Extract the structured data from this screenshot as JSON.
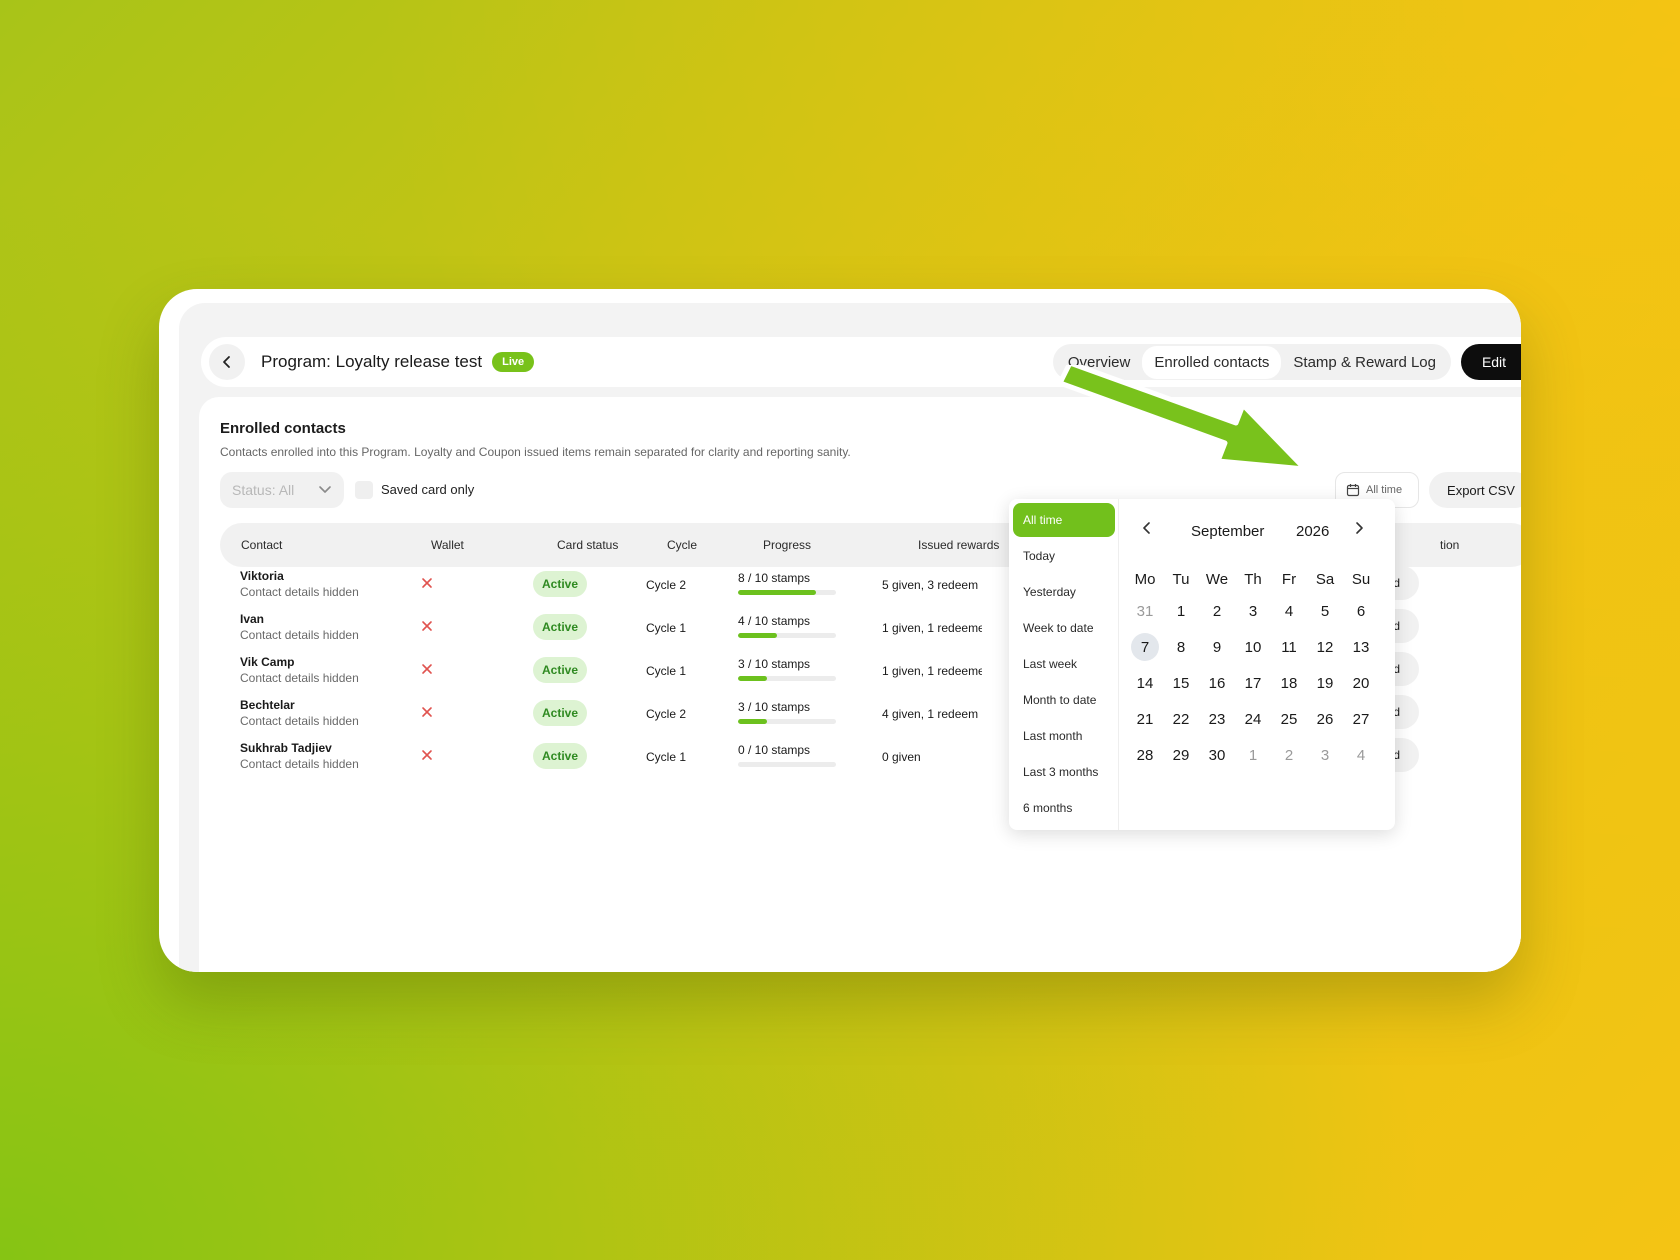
{
  "header": {
    "title": "Program: Loyalty release test",
    "badge": "Live",
    "tabs": [
      {
        "label": "Overview"
      },
      {
        "label": "Enrolled contacts"
      },
      {
        "label": "Stamp & Reward Log"
      }
    ],
    "edit_label": "Edit"
  },
  "section": {
    "title": "Enrolled contacts",
    "description": "Contacts enrolled into this Program. Loyalty and Coupon issued items remain separated for clarity and reporting sanity."
  },
  "filters": {
    "status_value": "Status: All",
    "saved_card_label": "Saved card only",
    "date_range_label": "All time",
    "export_label": "Export CSV"
  },
  "table": {
    "headers": {
      "contact": "Contact",
      "wallet": "Wallet",
      "card_status": "Card status",
      "cycle": "Cycle",
      "progress": "Progress",
      "issued_rewards": "Issued rewards",
      "action_partial": "tion"
    },
    "rows": [
      {
        "name": "Viktoria",
        "sub": "Contact details hidden",
        "status": "Active",
        "cycle": "Cycle 2",
        "progress_text": "8 / 10 stamps",
        "progress": 0.8,
        "rewards": "5 given, 3 redeem",
        "action": "Open card"
      },
      {
        "name": "Ivan",
        "sub": "Contact details hidden",
        "status": "Active",
        "cycle": "Cycle 1",
        "progress_text": "4 / 10 stamps",
        "progress": 0.4,
        "rewards": "1 given, 1 redeeme",
        "action": "Open card"
      },
      {
        "name": "Vik Camp",
        "sub": "Contact details hidden",
        "status": "Active",
        "cycle": "Cycle 1",
        "progress_text": "3 / 10 stamps",
        "progress": 0.3,
        "rewards": "1 given, 1 redeeme",
        "action": "Open card"
      },
      {
        "name": "Bechtelar",
        "sub": "Contact details hidden",
        "status": "Active",
        "cycle": "Cycle 2",
        "progress_text": "3 / 10 stamps",
        "progress": 0.3,
        "rewards": "4 given, 1 redeem",
        "action": "Open card"
      },
      {
        "name": "Sukhrab Tadjiev",
        "sub": "Contact details hidden",
        "status": "Active",
        "cycle": "Cycle 1",
        "progress_text": "0 / 10 stamps",
        "progress": 0.0,
        "rewards": "0 given",
        "action": "Open card"
      }
    ]
  },
  "date_picker": {
    "presets": [
      "All time",
      "Today",
      "Yesterday",
      "Week to date",
      "Last week",
      "Month to date",
      "Last month",
      "Last 3 months",
      "6 months"
    ],
    "selected_preset": "All time",
    "month": "September",
    "year": "2026",
    "weekdays": [
      "Mo",
      "Tu",
      "We",
      "Th",
      "Fr",
      "Sa",
      "Su"
    ],
    "weeks": [
      [
        "31",
        "1",
        "2",
        "3",
        "4",
        "5",
        "6"
      ],
      [
        "7",
        "8",
        "9",
        "10",
        "11",
        "12",
        "13"
      ],
      [
        "14",
        "15",
        "16",
        "17",
        "18",
        "19",
        "20"
      ],
      [
        "21",
        "22",
        "23",
        "24",
        "25",
        "26",
        "27"
      ],
      [
        "28",
        "29",
        "30",
        "1",
        "2",
        "3",
        "4"
      ]
    ],
    "selected_day": "7"
  },
  "colors": {
    "accent": "#78c21a",
    "active_badge_bg": "#ddf3d2",
    "active_badge_text": "#2f8a21",
    "wallet_x": "#e0534f"
  }
}
